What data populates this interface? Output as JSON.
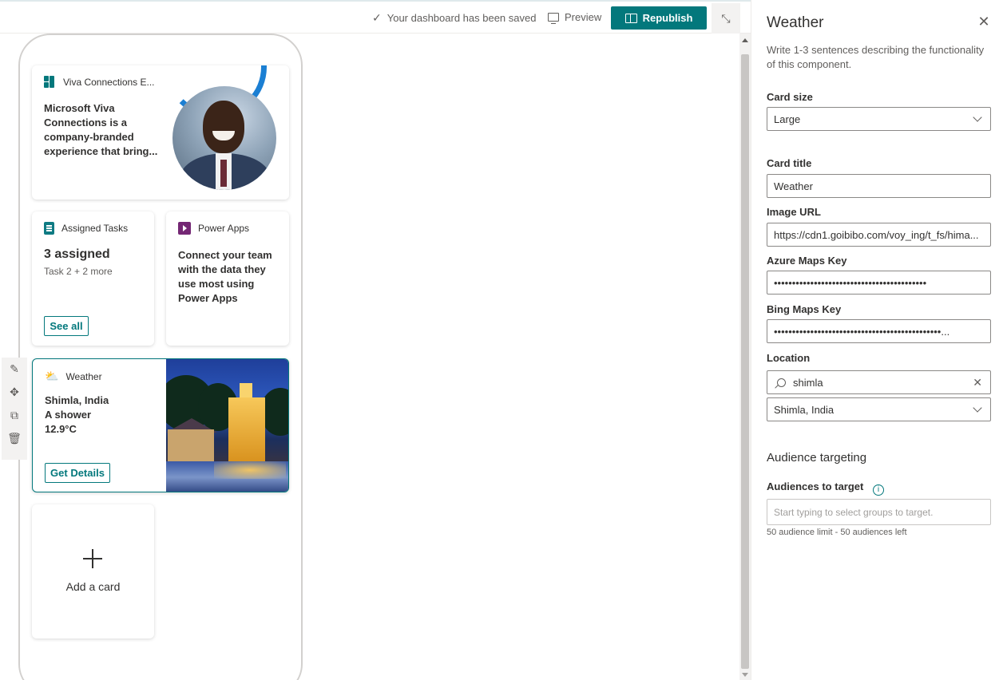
{
  "toolbar": {
    "saved_text": "Your dashboard has been saved",
    "preview_label": "Preview",
    "republish_label": "Republish"
  },
  "cards": {
    "viva": {
      "title": "Viva Connections E...",
      "body": "Microsoft Viva Connections is a company-branded experience that bring..."
    },
    "tasks": {
      "title": "Assigned Tasks",
      "headline": "3 assigned",
      "sub": "Task 2 + 2 more",
      "button": "See all"
    },
    "power": {
      "title": "Power Apps",
      "body": "Connect your team with the data they use most using Power Apps"
    },
    "weather": {
      "title": "Weather",
      "location": "Shimla, India",
      "condition": "A shower",
      "temperature": "12.9°C",
      "button": "Get Details"
    },
    "add": {
      "label": "Add a card"
    }
  },
  "pane": {
    "title": "Weather",
    "description": "Write 1-3 sentences describing the functionality of this component.",
    "card_size_label": "Card size",
    "card_size_value": "Large",
    "card_title_label": "Card title",
    "card_title_value": "Weather",
    "image_url_label": "Image URL",
    "image_url_value": "https://cdn1.goibibo.com/voy_ing/t_fs/hima...",
    "azure_key_label": "Azure Maps Key",
    "azure_key_value": "••••••••••••••••••••••••••••••••••••••••••",
    "bing_key_label": "Bing Maps Key",
    "bing_key_value": "••••••••••••••••••••••••••••••••••••••••••••••...",
    "location_label": "Location",
    "location_search_value": "shimla",
    "location_selected": "Shimla, India",
    "audience_heading": "Audience targeting",
    "audiences_label": "Audiences to target",
    "audiences_placeholder": "Start typing to select groups to target.",
    "audience_hint": "50 audience limit - 50 audiences left"
  },
  "colors": {
    "accent": "#03787c",
    "power_apps": "#742774",
    "ring": "#1b7fd3"
  }
}
